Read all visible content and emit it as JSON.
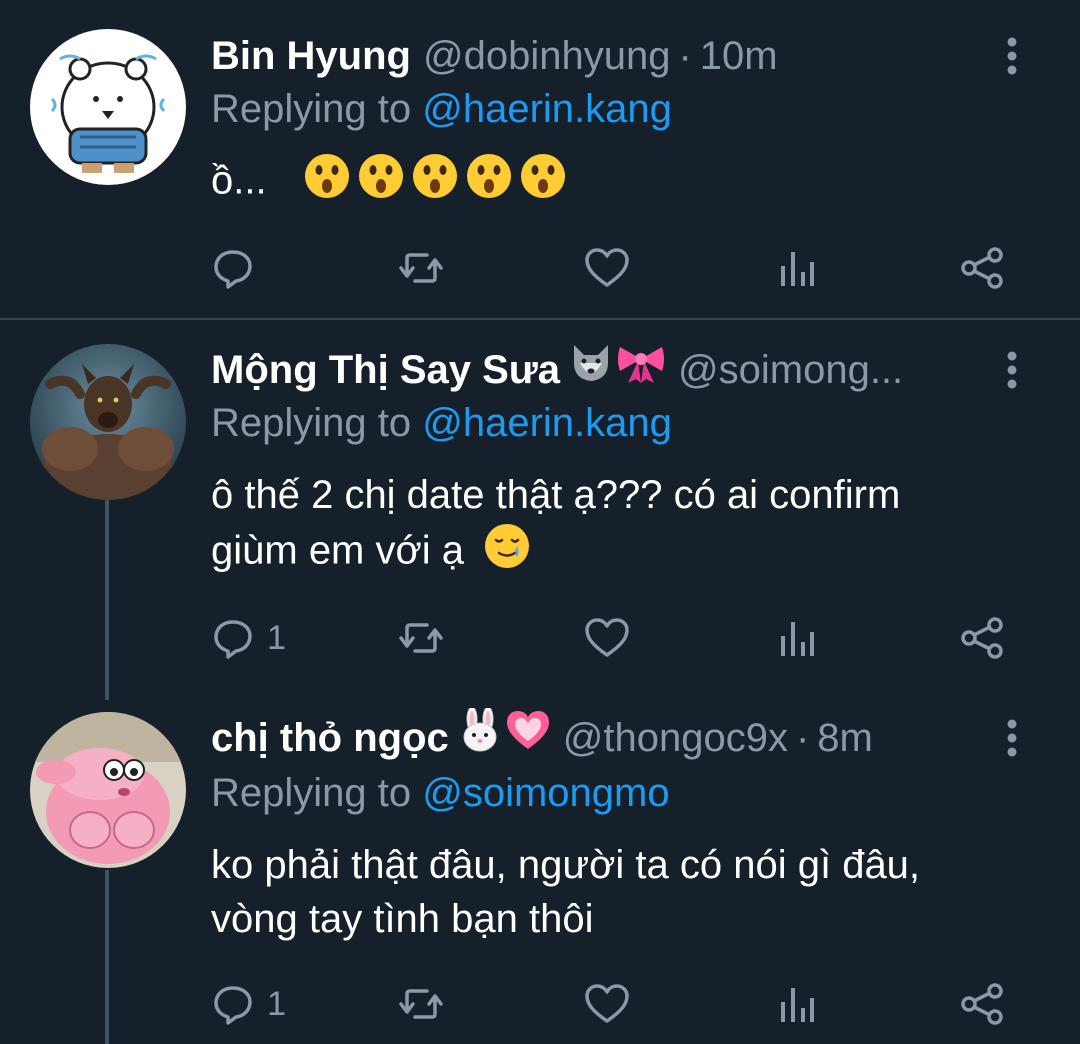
{
  "tweets": [
    {
      "name": "Bin Hyung",
      "handle": "@dobinhyung",
      "dot": "·",
      "time": "10m",
      "replying_prefix": "Replying to ",
      "replying_to": "@haerin.kang",
      "text": "ồ...",
      "emoji_after_text": [
        "hushed-face",
        "hushed-face",
        "hushed-face",
        "hushed-face",
        "hushed-face"
      ],
      "reply_count": "",
      "avatar": "white-bear-avatar"
    },
    {
      "name": "Mộng Thị Say Sưa",
      "name_badges": [
        "wolf-emoji",
        "ribbon-emoji"
      ],
      "handle": "@soimong...",
      "replying_prefix": "Replying to ",
      "replying_to": "@haerin.kang",
      "text_line1": "ô thế 2 chị date thật ạ??? có ai confirm",
      "text_line2": "giùm em với ạ",
      "emoji_after_text": [
        "face-holding-back-tears"
      ],
      "reply_count": "1",
      "avatar": "werewolf-avatar"
    },
    {
      "name": "chị thỏ ngọc",
      "name_badges": [
        "rabbit-face-emoji",
        "heart-emoji"
      ],
      "handle": "@thongoc9x",
      "dot": "·",
      "time": "8m",
      "replying_prefix": "Replying to ",
      "replying_to": "@soimongmo",
      "text_line1": "ko phải thật đâu, người ta có nói gì đâu,",
      "text_line2": "vòng tay tình bạn thôi",
      "reply_count": "1",
      "avatar": "pink-cartoon-avatar"
    }
  ],
  "action_icons": [
    "reply-icon",
    "retweet-icon",
    "like-icon",
    "analytics-icon",
    "share-icon"
  ],
  "colors": {
    "background": "#15202b",
    "divider": "#38444d",
    "secondary_text": "#8b98a5",
    "link": "#1d9bf0"
  }
}
